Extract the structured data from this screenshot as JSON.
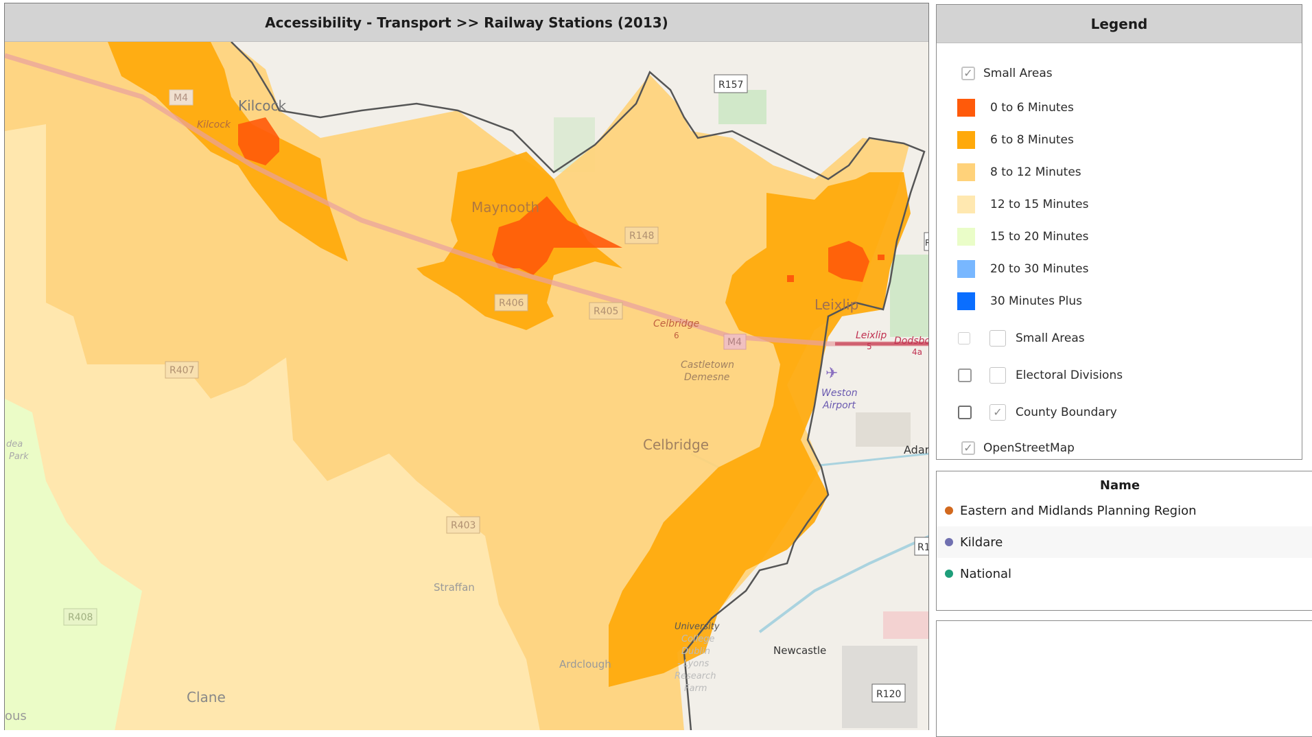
{
  "map": {
    "title": "Accessibility - Transport >>  Railway Stations (2013)",
    "labels": {
      "kilcock": "Kilcock",
      "kilcock_small": "Kilcock",
      "maynooth": "Maynooth",
      "leixlip": "Leixlip",
      "celbridge": "Celbridge",
      "celbridge_small": "Celbridge",
      "celbridge_num": "6",
      "castletown1": "Castletown",
      "castletown2": "Demesne",
      "clane": "Clane",
      "straffan": "Straffan",
      "ardclough": "Ardclough",
      "newcastle": "Newcastle",
      "weston1": "Weston",
      "weston2": "Airport",
      "leixlip_junction": "Leixlip",
      "leixlip_junction_num": "5",
      "dodsboro": "Dodsboro",
      "dodsboro_num": "4a",
      "adam": "Adam",
      "university1": "University",
      "university2": "College",
      "university3": "Dublin",
      "university4": "- Lyons",
      "university5": "Research",
      "university6": "Farm",
      "ous": "ous",
      "idea1": "dea",
      "idea2": "Park",
      "m4_west": "M4",
      "m4_east": "M4",
      "r157": "R157",
      "r148": "R148",
      "r406": "R406",
      "r405": "R405",
      "r407": "R407",
      "r403": "R403",
      "r408": "R408",
      "r120": "R120",
      "r1": "R1",
      "r_edge": "R"
    }
  },
  "legend": {
    "title": "Legend",
    "layer_label": "Small Areas",
    "classes": [
      {
        "label": "0 to 6 Minutes",
        "color": "#ff5a0a"
      },
      {
        "label": "6 to 8 Minutes",
        "color": "#ffa90a"
      },
      {
        "label": "8 to 12 Minutes",
        "color": "#ffd27a"
      },
      {
        "label": "12 to 15 Minutes",
        "color": "#ffe8b0"
      },
      {
        "label": "15 to 20 Minutes",
        "color": "#eafdc8"
      },
      {
        "label": "20 to 30 Minutes",
        "color": "#78b7ff"
      },
      {
        "label": "30 Minutes Plus",
        "color": "#0a6eff"
      }
    ],
    "overlays": {
      "small_areas": "Small Areas",
      "electoral_divisions": "Electoral Divisions",
      "county_boundary": "County Boundary",
      "openstreetmap": "OpenStreetMap"
    },
    "check_mark": "✓"
  },
  "names": {
    "header": "Name",
    "rows": [
      {
        "label": "Eastern and Midlands Planning Region",
        "color": "#d2691e"
      },
      {
        "label": "Kildare",
        "color": "#7070b0"
      },
      {
        "label": "National",
        "color": "#1e9e7a"
      }
    ]
  }
}
